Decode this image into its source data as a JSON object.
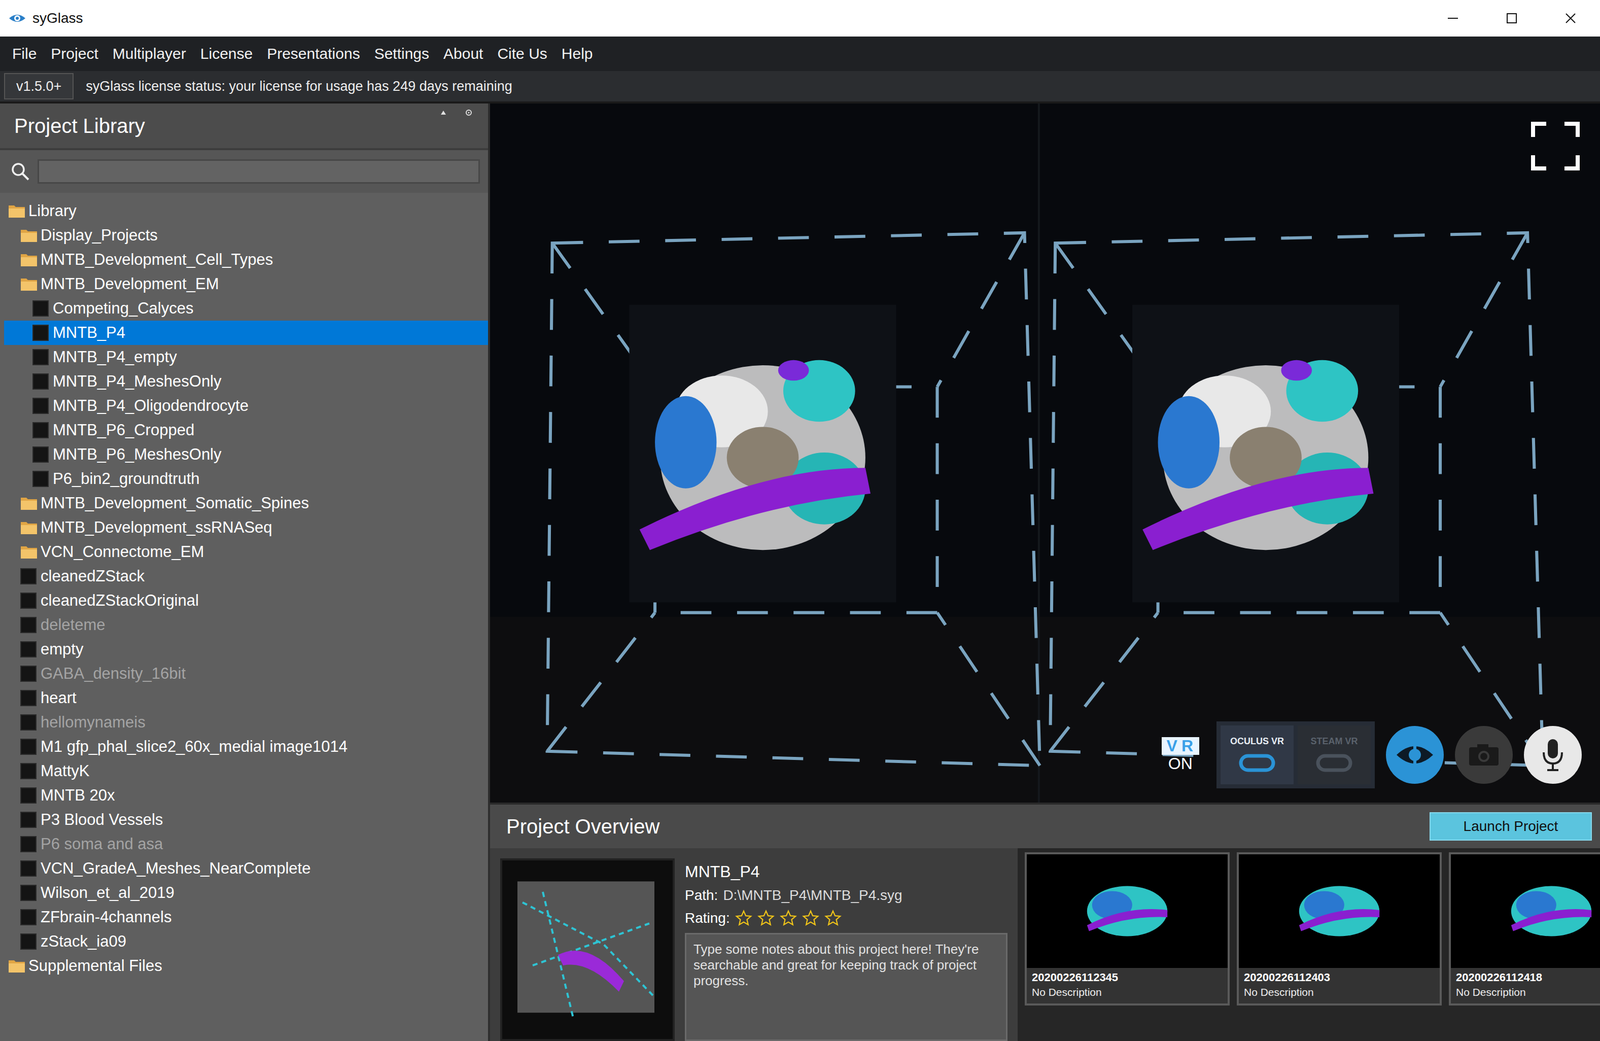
{
  "window": {
    "title": "syGlass"
  },
  "menu": [
    {
      "label": "File"
    },
    {
      "label": "Project"
    },
    {
      "label": "Multiplayer"
    },
    {
      "label": "License"
    },
    {
      "label": "Presentations"
    },
    {
      "label": "Settings"
    },
    {
      "label": "About"
    },
    {
      "label": "Cite Us"
    },
    {
      "label": "Help"
    }
  ],
  "status_bar": {
    "version": "v1.5.0+",
    "message": "syGlass license status: your license for usage has 249 days remaining"
  },
  "library": {
    "title": "Project Library",
    "search": {
      "value": ""
    },
    "tree": [
      {
        "label": "Library",
        "kind": "folder",
        "expanded": true,
        "selected": false,
        "disabled": false,
        "children": [
          {
            "label": "Display_Projects",
            "kind": "folder",
            "expanded": false,
            "selected": false,
            "disabled": false
          },
          {
            "label": "MNTB_Development_Cell_Types",
            "kind": "folder",
            "expanded": false,
            "selected": false,
            "disabled": false
          },
          {
            "label": "MNTB_Development_EM",
            "kind": "folder",
            "expanded": true,
            "selected": false,
            "disabled": false,
            "children": [
              {
                "label": "Competing_Calyces",
                "kind": "project",
                "selected": false,
                "disabled": false
              },
              {
                "label": "MNTB_P4",
                "kind": "project",
                "selected": true,
                "disabled": false
              },
              {
                "label": "MNTB_P4_empty",
                "kind": "project",
                "selected": false,
                "disabled": false
              },
              {
                "label": "MNTB_P4_MeshesOnly",
                "kind": "project",
                "selected": false,
                "disabled": false
              },
              {
                "label": "MNTB_P4_Oligodendrocyte",
                "kind": "project",
                "selected": false,
                "disabled": false
              },
              {
                "label": "MNTB_P6_Cropped",
                "kind": "project",
                "selected": false,
                "disabled": false
              },
              {
                "label": "MNTB_P6_MeshesOnly",
                "kind": "project",
                "selected": false,
                "disabled": false
              },
              {
                "label": "P6_bin2_groundtruth",
                "kind": "project",
                "selected": false,
                "disabled": false
              }
            ]
          },
          {
            "label": "MNTB_Development_Somatic_Spines",
            "kind": "folder",
            "expanded": false,
            "selected": false,
            "disabled": false
          },
          {
            "label": "MNTB_Development_ssRNASeq",
            "kind": "folder",
            "expanded": false,
            "selected": false,
            "disabled": false
          },
          {
            "label": "VCN_Connectome_EM",
            "kind": "folder",
            "expanded": false,
            "selected": false,
            "disabled": false
          },
          {
            "label": "cleanedZStack",
            "kind": "project",
            "selected": false,
            "disabled": false
          },
          {
            "label": "cleanedZStackOriginal",
            "kind": "project",
            "selected": false,
            "disabled": false
          },
          {
            "label": "deleteme",
            "kind": "project",
            "selected": false,
            "disabled": true
          },
          {
            "label": "empty",
            "kind": "project",
            "selected": false,
            "disabled": false
          },
          {
            "label": "GABA_density_16bit",
            "kind": "project",
            "selected": false,
            "disabled": true
          },
          {
            "label": "heart",
            "kind": "project",
            "selected": false,
            "disabled": false
          },
          {
            "label": "hellomynameis",
            "kind": "project",
            "selected": false,
            "disabled": true
          },
          {
            "label": "M1 gfp_phal_slice2_60x_medial image1014",
            "kind": "project",
            "selected": false,
            "disabled": false
          },
          {
            "label": "MattyK",
            "kind": "project",
            "selected": false,
            "disabled": false
          },
          {
            "label": "MNTB 20x",
            "kind": "project",
            "selected": false,
            "disabled": false
          },
          {
            "label": "P3 Blood Vessels",
            "kind": "project",
            "selected": false,
            "disabled": false
          },
          {
            "label": "P6 soma and asa",
            "kind": "project",
            "selected": false,
            "disabled": true
          },
          {
            "label": "VCN_GradeA_Meshes_NearComplete",
            "kind": "project",
            "selected": false,
            "disabled": false
          },
          {
            "label": "Wilson_et_al_2019",
            "kind": "project",
            "selected": false,
            "disabled": false
          },
          {
            "label": "ZFbrain-4channels",
            "kind": "project",
            "selected": false,
            "disabled": false
          },
          {
            "label": "zStack_ia09",
            "kind": "project",
            "selected": false,
            "disabled": false
          }
        ]
      },
      {
        "label": "Supplemental Files",
        "kind": "folder",
        "expanded": false,
        "selected": false,
        "disabled": false
      }
    ]
  },
  "viewport": {
    "vr": {
      "label": "VR",
      "state": "ON",
      "on": true
    },
    "headsets": [
      {
        "label": "OCULUS VR",
        "selected": true
      },
      {
        "label": "STEAM VR",
        "selected": false
      }
    ]
  },
  "overview": {
    "title": "Project Overview",
    "launch": "Launch Project",
    "name": "MNTB_P4",
    "path_label": "Path:",
    "path": "D:\\MNTB_P4\\MNTB_P4.syg",
    "rating_label": "Rating:",
    "stars": 0,
    "stars_max": 5,
    "notes": "Type some notes about this project here! They're searchable and great for keeping track of project progress.",
    "snapshots": [
      {
        "time": "20200226112345",
        "description": "No Description"
      },
      {
        "time": "20200226112403",
        "description": "No Description"
      },
      {
        "time": "20200226112418",
        "description": "No Description"
      }
    ]
  }
}
